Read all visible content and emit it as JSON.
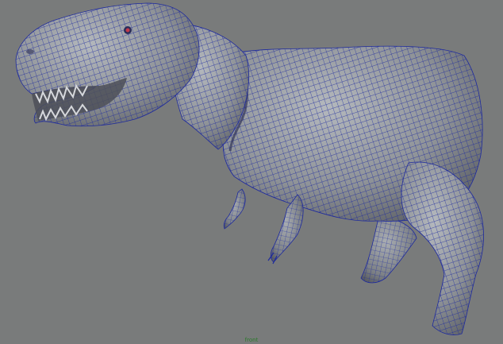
{
  "viewport": {
    "camera_label": "front",
    "background_color": "#797b7b",
    "model": {
      "subject": "t-rex-model",
      "display_mode": "wireframe-on-shaded",
      "surface_color": "#8d9196",
      "wire_color": "#1e2a9e",
      "eye_color": "#c23a4a"
    }
  }
}
